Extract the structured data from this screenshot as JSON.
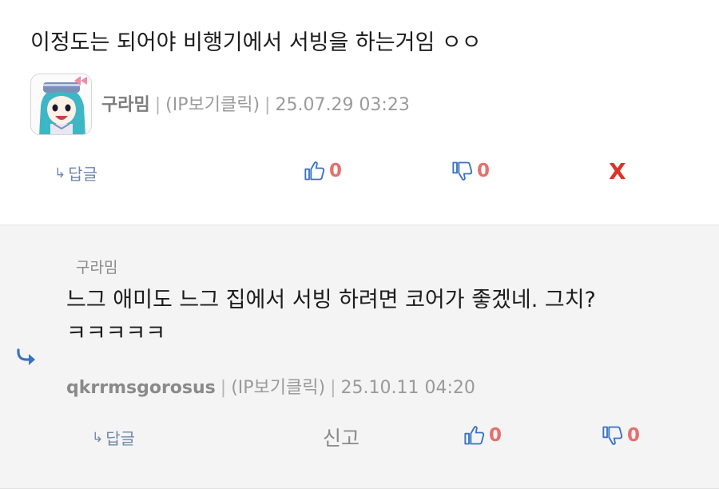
{
  "comment": {
    "text": "이정도는 되어야 비행기에서 서빙을 하는거임 ㅇㅇ",
    "nickname": "구라밈",
    "ip_label": "(IP보기클릭)",
    "datetime": "25.07.29 03:23",
    "reply_label": "답글",
    "upvotes": "0",
    "downvotes": "0",
    "delete_label": "X"
  },
  "reply": {
    "reply_to": "구라밈",
    "text_line1": "느그 애미도 느그 집에서 서빙 하려면 코어가 좋겠네. 그치?",
    "text_line2": "ㅋㅋㅋㅋㅋ",
    "nickname": "qkrrmsgorosus",
    "ip_label": "(IP보기클릭)",
    "datetime": "25.10.11 04:20",
    "reply_label": "답글",
    "report_label": "신고",
    "upvotes": "0",
    "downvotes": "0"
  },
  "icons": {
    "reply": "reply-arrow-icon",
    "thumbs_up": "thumbs-up-icon",
    "thumbs_down": "thumbs-down-icon",
    "nested_reply": "nested-reply-arrow-icon",
    "avatar": "anime-avatar"
  },
  "colors": {
    "accent_blue": "#3a72c4",
    "vote_count": "#e4706e",
    "delete_red": "#d9332a",
    "reply_bg": "#f4f4f4"
  }
}
